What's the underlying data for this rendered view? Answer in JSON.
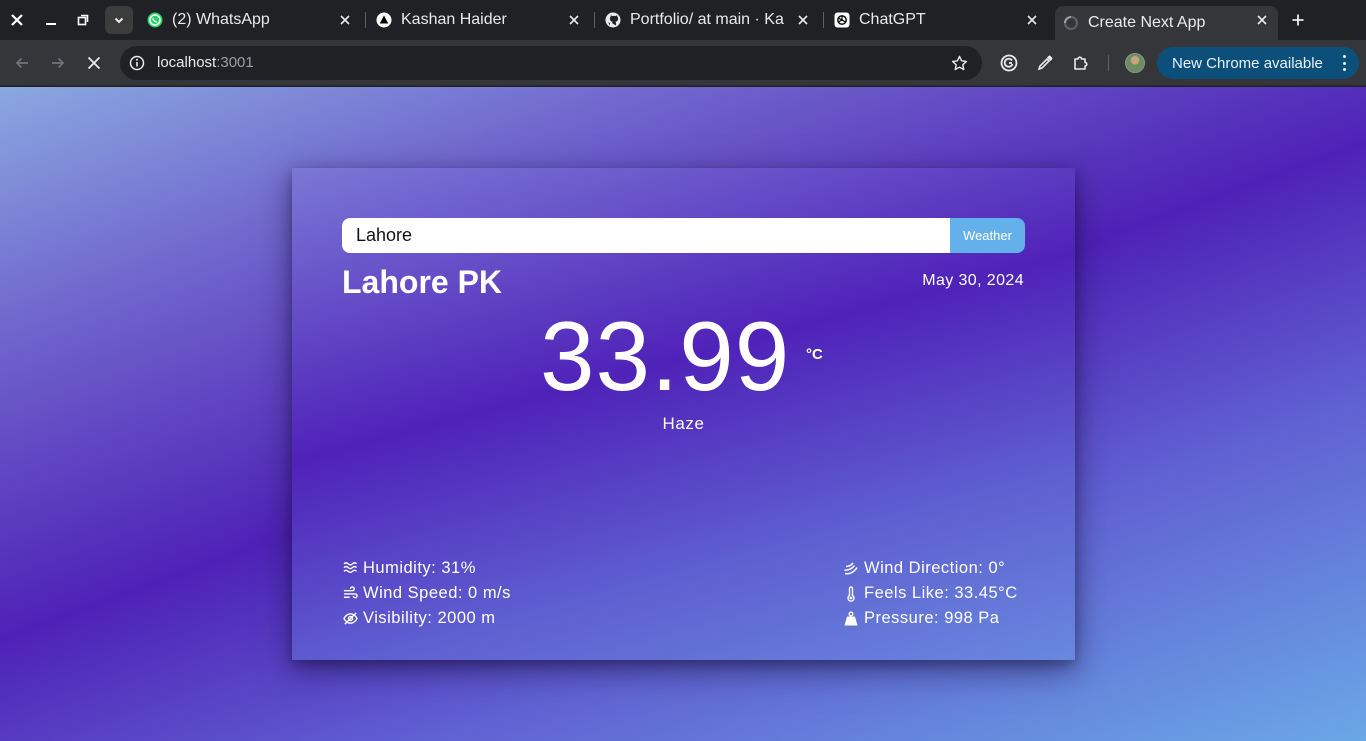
{
  "browser": {
    "tabs": [
      {
        "label": "(2) WhatsApp",
        "icon": "whatsapp-icon"
      },
      {
        "label": "Kashan Haider",
        "icon": "triangle-logo-icon"
      },
      {
        "label": "Portfolio/ at main · Ka",
        "icon": "github-icon"
      },
      {
        "label": "ChatGPT",
        "icon": "chatgpt-icon"
      },
      {
        "label": "Create Next App",
        "icon": "loading-spinner-icon",
        "active": true
      }
    ],
    "url_host": "localhost",
    "url_port": ":3001",
    "update_label": "New Chrome available",
    "colors": {
      "tabstrip": "#202124",
      "toolbar": "#35363a",
      "update_pill": "#0b4f7a"
    }
  },
  "app": {
    "search": {
      "value": "Lahore",
      "button_label": "Weather"
    },
    "location": "Lahore PK",
    "date": "May 30, 2024",
    "temperature": "33.99",
    "unit": "°C",
    "condition": "Haze",
    "stats_left": [
      {
        "icon": "humidity-waves-icon",
        "label": "Humidity: 31%"
      },
      {
        "icon": "wind-icon",
        "label": "Wind Speed: 0 m/s"
      },
      {
        "icon": "visibility-off-icon",
        "label": "Visibility: 2000 m"
      }
    ],
    "stats_right": [
      {
        "icon": "wind-direction-icon",
        "label": "Wind Direction: 0°"
      },
      {
        "icon": "thermometer-icon",
        "label": "Feels Like: 33.45°C"
      },
      {
        "icon": "pressure-weight-icon",
        "label": "Pressure: 998 Pa"
      }
    ],
    "colors": {
      "button": "#64b0ea",
      "card_top": "#7a78d6",
      "card_mid": "#4f22b8",
      "card_bottom": "#6888de"
    }
  }
}
